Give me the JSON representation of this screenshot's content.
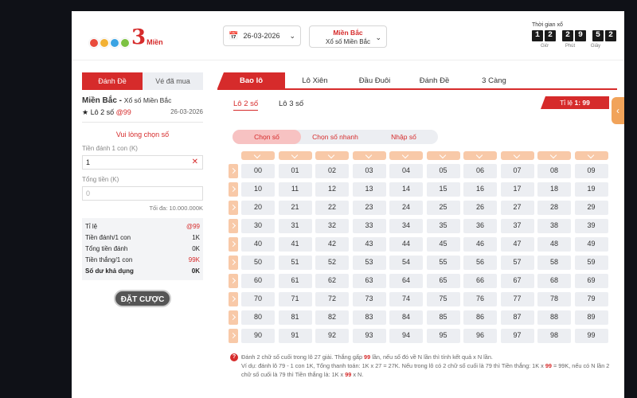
{
  "header": {
    "logo_colors": [
      "#e94b3c",
      "#f2b134",
      "#3aa3e3",
      "#7cc142",
      "#e94b8a"
    ],
    "logo_number": "3",
    "logo_text": "Miền",
    "date": "26-03-2026",
    "region_title": "Miền Bắc",
    "region_sub": "Xổ số Miền Bắc",
    "countdown_title": "Thời gian xổ",
    "countdown_digits": [
      "1",
      "2",
      "2",
      "9",
      "5",
      "2"
    ],
    "units": [
      "Giờ",
      "Phút",
      "Giây"
    ]
  },
  "left": {
    "tab_bet": "Đánh Đề",
    "tab_purchased": "Vé đã mua",
    "region": "Miền Bắc",
    "region_dash": " - ",
    "region_sub": "Xổ số Miền Bắc",
    "star": "★",
    "game_label": "Lô 2 số",
    "odds": "@99",
    "date": "26-03-2026",
    "please_choose": "Vui lòng chọn số",
    "bet_per_label": "Tiền đánh 1 con (K)",
    "bet_per_value": "1",
    "total_label": "Tổng tiền (K)",
    "total_placeholder": "0",
    "max_text": "Tối đa: 10.000.000K",
    "summary": [
      {
        "label": "Tỉ lệ",
        "value": "@99",
        "red": true
      },
      {
        "label": "Tiền đánh/1 con",
        "value": "1K"
      },
      {
        "label": "Tổng tiền đánh",
        "value": "0K"
      },
      {
        "label": "Tiền thắng/1 con",
        "value": "99K",
        "red": true
      },
      {
        "label": "Số dư khả dụng",
        "value": "0K",
        "bold": true
      }
    ],
    "bet_button": "ĐẶT CƯỢC"
  },
  "right": {
    "tabs": [
      "Bao lô",
      "Lô Xiên",
      "Đầu Đuôi",
      "Đánh Đề",
      "3 Càng"
    ],
    "subtabs": [
      "Lô 2 số",
      "Lô 3 số"
    ],
    "rate_label": "Tỉ lệ ",
    "rate_value": "1: 99",
    "pills": [
      "Chọn số",
      "Chọn số nhanh",
      "Nhập số"
    ],
    "numbers": [
      [
        "00",
        "01",
        "02",
        "03",
        "04",
        "05",
        "06",
        "07",
        "08",
        "09"
      ],
      [
        "10",
        "11",
        "12",
        "13",
        "14",
        "15",
        "16",
        "17",
        "18",
        "19"
      ],
      [
        "20",
        "21",
        "22",
        "23",
        "24",
        "25",
        "26",
        "27",
        "28",
        "29"
      ],
      [
        "30",
        "31",
        "32",
        "33",
        "34",
        "35",
        "36",
        "37",
        "38",
        "39"
      ],
      [
        "40",
        "41",
        "42",
        "43",
        "44",
        "45",
        "46",
        "47",
        "48",
        "49"
      ],
      [
        "50",
        "51",
        "52",
        "53",
        "54",
        "55",
        "56",
        "57",
        "58",
        "59"
      ],
      [
        "60",
        "61",
        "62",
        "63",
        "64",
        "65",
        "66",
        "67",
        "68",
        "69"
      ],
      [
        "70",
        "71",
        "72",
        "73",
        "74",
        "75",
        "76",
        "77",
        "78",
        "79"
      ],
      [
        "80",
        "81",
        "82",
        "83",
        "84",
        "85",
        "86",
        "87",
        "88",
        "89"
      ],
      [
        "90",
        "91",
        "92",
        "93",
        "94",
        "95",
        "96",
        "97",
        "98",
        "99"
      ]
    ],
    "note_line1_a": "Đánh 2 chữ số cuối trong lô 27 giải. Thắng gấp ",
    "note_line1_hl": "99",
    "note_line1_b": " lần, nếu số đó về N lần thì tính kết quả x N lần.",
    "note_line2_a": "Ví dụ: đánh lô 79 - 1 con 1K, Tổng thanh toán: 1K x 27 = 27K. Nếu trong lô có 2 chữ số cuối là 79 thì Tiền thắng: 1K x ",
    "note_line2_hl": "99",
    "note_line2_b": " = 99K, nếu có N lần 2 chữ số cuối là 79 thì Tiền thắng là: 1K x ",
    "note_line2_hl2": "99",
    "note_line2_c": " x N."
  }
}
